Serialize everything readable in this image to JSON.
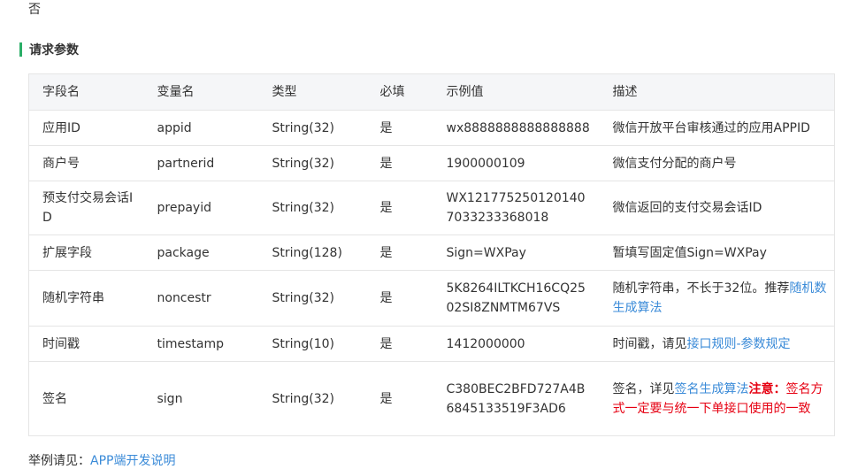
{
  "top_text": "否",
  "section": {
    "title": "请求参数"
  },
  "table": {
    "headers": [
      "字段名",
      "变量名",
      "类型",
      "必填",
      "示例值",
      "描述"
    ],
    "rows": [
      {
        "field": "应用ID",
        "var": "appid",
        "type": "String(32)",
        "required": "是",
        "example": "wx8888888888888888",
        "desc_text": "微信开放平台审核通过的应用APPID"
      },
      {
        "field": "商户号",
        "var": "partnerid",
        "type": "String(32)",
        "required": "是",
        "example": "1900000109",
        "desc_text": "微信支付分配的商户号"
      },
      {
        "field": "预支付交易会话ID",
        "var": "prepayid",
        "type": "String(32)",
        "required": "是",
        "example": "WX1217752501201407033233368018",
        "desc_text": "微信返回的支付交易会话ID"
      },
      {
        "field": "扩展字段",
        "var": "package",
        "type": "String(128)",
        "required": "是",
        "example": "Sign=WXPay",
        "desc_text": "暂填写固定值Sign=WXPay"
      },
      {
        "field": "随机字符串",
        "var": "noncestr",
        "type": "String(32)",
        "required": "是",
        "example": "5K8264ILTKCH16CQ2502SI8ZNMTM67VS",
        "desc_text": "随机字符串，不长于32位。推荐",
        "desc_link": "随机数生成算法"
      },
      {
        "field": "时间戳",
        "var": "timestamp",
        "type": "String(10)",
        "required": "是",
        "example": "1412000000",
        "desc_text": "时间戳，请见",
        "desc_link": "接口规则-参数规定"
      },
      {
        "field": "签名",
        "var": "sign",
        "type": "String(32)",
        "required": "是",
        "example": "C380BEC2BFD727A4B6845133519F3AD6",
        "desc_text": "签名，详见",
        "desc_link": "签名生成算法",
        "desc_warn_label": "注意：",
        "desc_warn": "签名方式一定要与统一下单接口使用的一致"
      }
    ]
  },
  "footer": {
    "prefix": "举例请见：",
    "link": "APP端开发说明"
  },
  "colors": {
    "accent_green": "#2aae67",
    "link_blue": "#3b8bd8",
    "warning_red": "#e60012",
    "header_bg": "#f5f6f8"
  }
}
